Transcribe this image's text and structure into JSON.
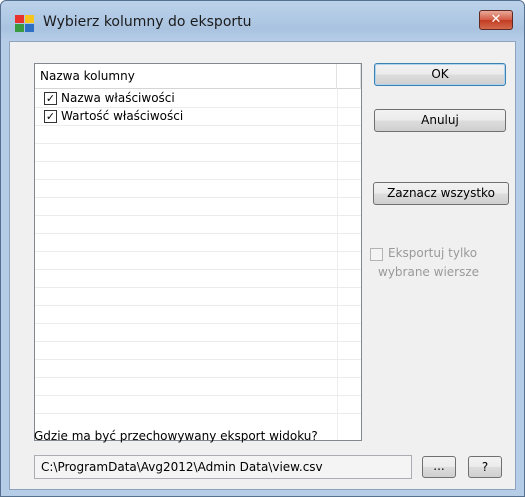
{
  "window": {
    "title": "Wybierz kolumny do eksportu",
    "close_glyph": "✕"
  },
  "list": {
    "column_header": "Nazwa kolumny",
    "rows": [
      {
        "label": "Nazwa właściwości",
        "checked": true,
        "mark": "✓"
      },
      {
        "label": "Wartość właściwości",
        "checked": true,
        "mark": "✓"
      },
      {
        "label": "",
        "checked": false,
        "mark": ""
      },
      {
        "label": "",
        "checked": false,
        "mark": ""
      },
      {
        "label": "",
        "checked": false,
        "mark": ""
      },
      {
        "label": "",
        "checked": false,
        "mark": ""
      },
      {
        "label": "",
        "checked": false,
        "mark": ""
      },
      {
        "label": "",
        "checked": false,
        "mark": ""
      },
      {
        "label": "",
        "checked": false,
        "mark": ""
      },
      {
        "label": "",
        "checked": false,
        "mark": ""
      },
      {
        "label": "",
        "checked": false,
        "mark": ""
      },
      {
        "label": "",
        "checked": false,
        "mark": ""
      },
      {
        "label": "",
        "checked": false,
        "mark": ""
      },
      {
        "label": "",
        "checked": false,
        "mark": ""
      },
      {
        "label": "",
        "checked": false,
        "mark": ""
      },
      {
        "label": "",
        "checked": false,
        "mark": ""
      },
      {
        "label": "",
        "checked": false,
        "mark": ""
      },
      {
        "label": "",
        "checked": false,
        "mark": ""
      }
    ]
  },
  "buttons": {
    "ok": "OK",
    "cancel": "Anuluj",
    "select_all": "Zaznacz wszystko",
    "browse": "...",
    "help": "?"
  },
  "export_selected": {
    "line1": "Eksportuj tylko",
    "line2": "wybrane wiersze",
    "checked": false,
    "enabled": false
  },
  "path": {
    "label": "Gdzie ma być przechowywany eksport widoku?",
    "value": "C:\\ProgramData\\Avg2012\\Admin Data\\view.csv"
  },
  "colors": {
    "title_bg": "#b6cde7",
    "close_red": "#c23c22",
    "default_button_border": "#3c7fb1"
  }
}
